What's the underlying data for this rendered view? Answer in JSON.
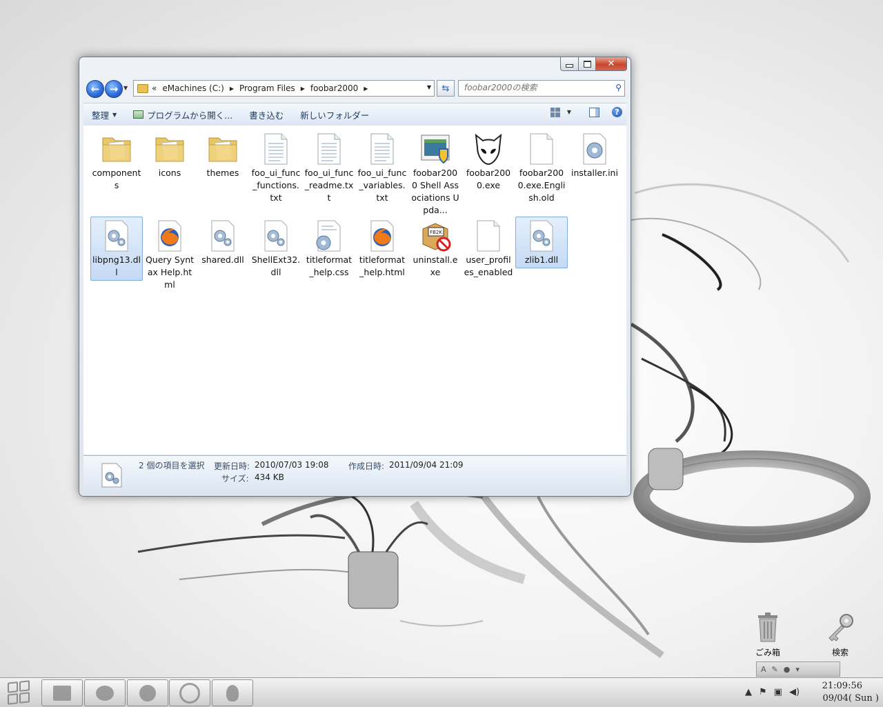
{
  "window": {
    "buttons": {
      "minimize": "minimize",
      "maximize": "maximize",
      "close": "✕"
    }
  },
  "address": {
    "overflow": "«",
    "segments": [
      "eMachines (C:)",
      "Program Files",
      "foobar2000"
    ]
  },
  "search": {
    "placeholder": "foobar2000の検索"
  },
  "toolbar": {
    "organize": "整理",
    "open_with": "プログラムから開く...",
    "burn": "書き込む",
    "new_folder": "新しいフォルダー"
  },
  "files": [
    {
      "name": "components",
      "icon": "folder-icon",
      "selected": false
    },
    {
      "name": "icons",
      "icon": "folder-icon",
      "selected": false
    },
    {
      "name": "themes",
      "icon": "folder-icon",
      "selected": false
    },
    {
      "name": "foo_ui_func_functions.txt",
      "icon": "text-file-icon",
      "selected": false
    },
    {
      "name": "foo_ui_func_readme.txt",
      "icon": "text-file-icon",
      "selected": false
    },
    {
      "name": "foo_ui_func_variables.txt",
      "icon": "text-file-icon",
      "selected": false
    },
    {
      "name": "foobar2000 Shell Associations Upda...",
      "icon": "shell-updater-icon",
      "selected": false
    },
    {
      "name": "foobar2000.exe",
      "icon": "foobar-alien-icon",
      "selected": false
    },
    {
      "name": "foobar2000.exe.English.old",
      "icon": "blank-file-icon",
      "selected": false
    },
    {
      "name": "installer.ini",
      "icon": "settings-file-icon",
      "selected": false
    },
    {
      "name": "libpng13.dll",
      "icon": "dll-file-icon",
      "selected": true
    },
    {
      "name": "Query Syntax Help.html",
      "icon": "firefox-icon",
      "selected": false
    },
    {
      "name": "shared.dll",
      "icon": "dll-file-icon",
      "selected": false
    },
    {
      "name": "ShellExt32.dll",
      "icon": "dll-file-icon",
      "selected": false
    },
    {
      "name": "titleformat_help.css",
      "icon": "css-file-icon",
      "selected": false
    },
    {
      "name": "titleformat_help.html",
      "icon": "firefox-icon",
      "selected": false
    },
    {
      "name": "uninstall.exe",
      "icon": "fb2k-uninstall-icon",
      "selected": false
    },
    {
      "name": "user_profiles_enabled",
      "icon": "blank-file-icon",
      "selected": false
    },
    {
      "name": "zlib1.dll",
      "icon": "dll-file-icon",
      "selected": true
    }
  ],
  "details": {
    "selection": "2 個の項目を選択",
    "modified_label": "更新日時:",
    "modified_value": "2010/07/03 19:08",
    "created_label": "作成日時:",
    "created_value": "2011/09/04 21:09",
    "size_label": "サイズ:",
    "size_value": "434 KB"
  },
  "desktop": {
    "recycle_bin": "ごみ箱",
    "key_icon_label": "検索"
  },
  "clock": {
    "time": "21:09:56",
    "date": "09/04( Sun )"
  }
}
